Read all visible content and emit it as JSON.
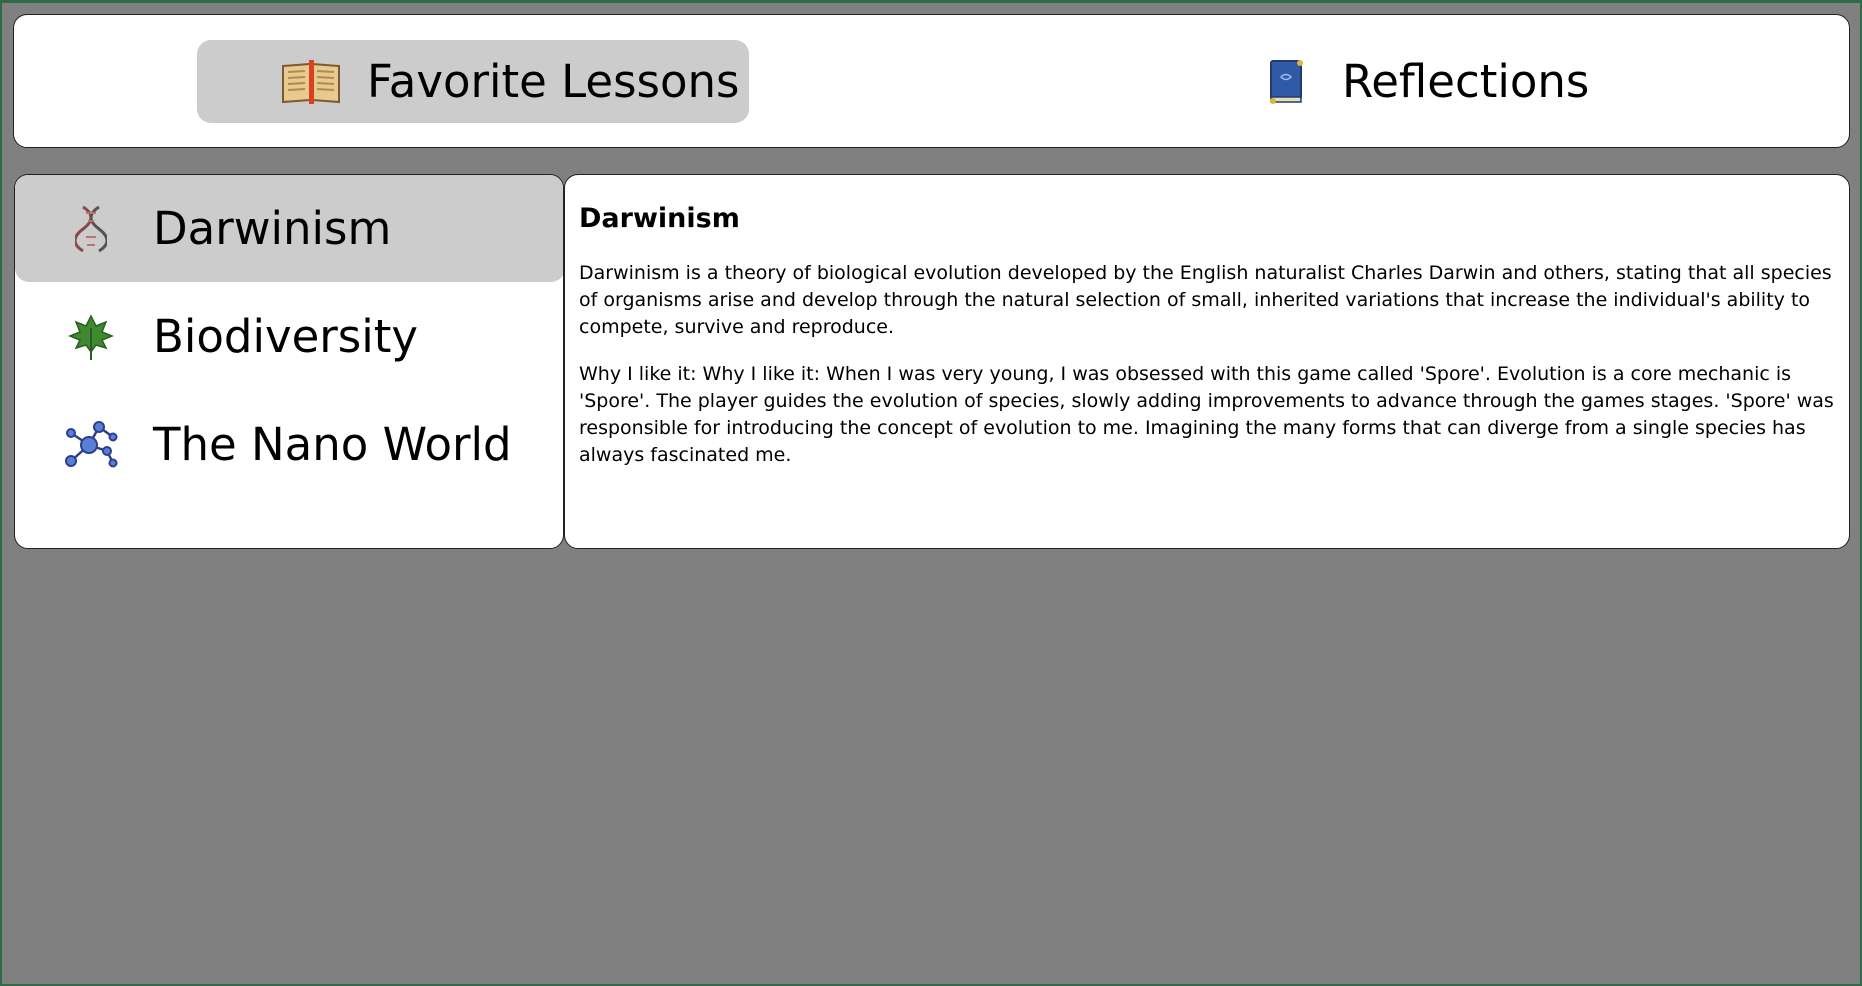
{
  "tabs": [
    {
      "label": "Favorite Lessons",
      "icon": "open-book-icon",
      "active": true
    },
    {
      "label": "Reflections",
      "icon": "blue-book-icon",
      "active": false
    }
  ],
  "lessons": [
    {
      "label": "Darwinism",
      "icon": "dna-icon",
      "active": true
    },
    {
      "label": "Biodiversity",
      "icon": "leaf-icon",
      "active": false
    },
    {
      "label": "The Nano World",
      "icon": "molecule-icon",
      "active": false
    }
  ],
  "detail": {
    "title": "Darwinism",
    "description": "Darwinism is a theory of biological evolution developed by the English naturalist Charles Darwin and others, stating that all species of organisms arise and develop through the natural selection of small, inherited variations that increase the individual's ability to compete, survive and reproduce.",
    "why": "Why I like it: Why I like it: When I was very young, I was obsessed with this game called 'Spore'. Evolution is a core mechanic is 'Spore'. The player guides the evolution of species, slowly adding improvements to advance through the games stages. 'Spore' was responsible for introducing the concept of evolution to me. Imagining the many forms that can diverge from a single species has always fascinated me."
  },
  "colors": {
    "background": "#808080",
    "panel": "#ffffff",
    "active": "#cccccc",
    "frame": "#2e6b46"
  }
}
